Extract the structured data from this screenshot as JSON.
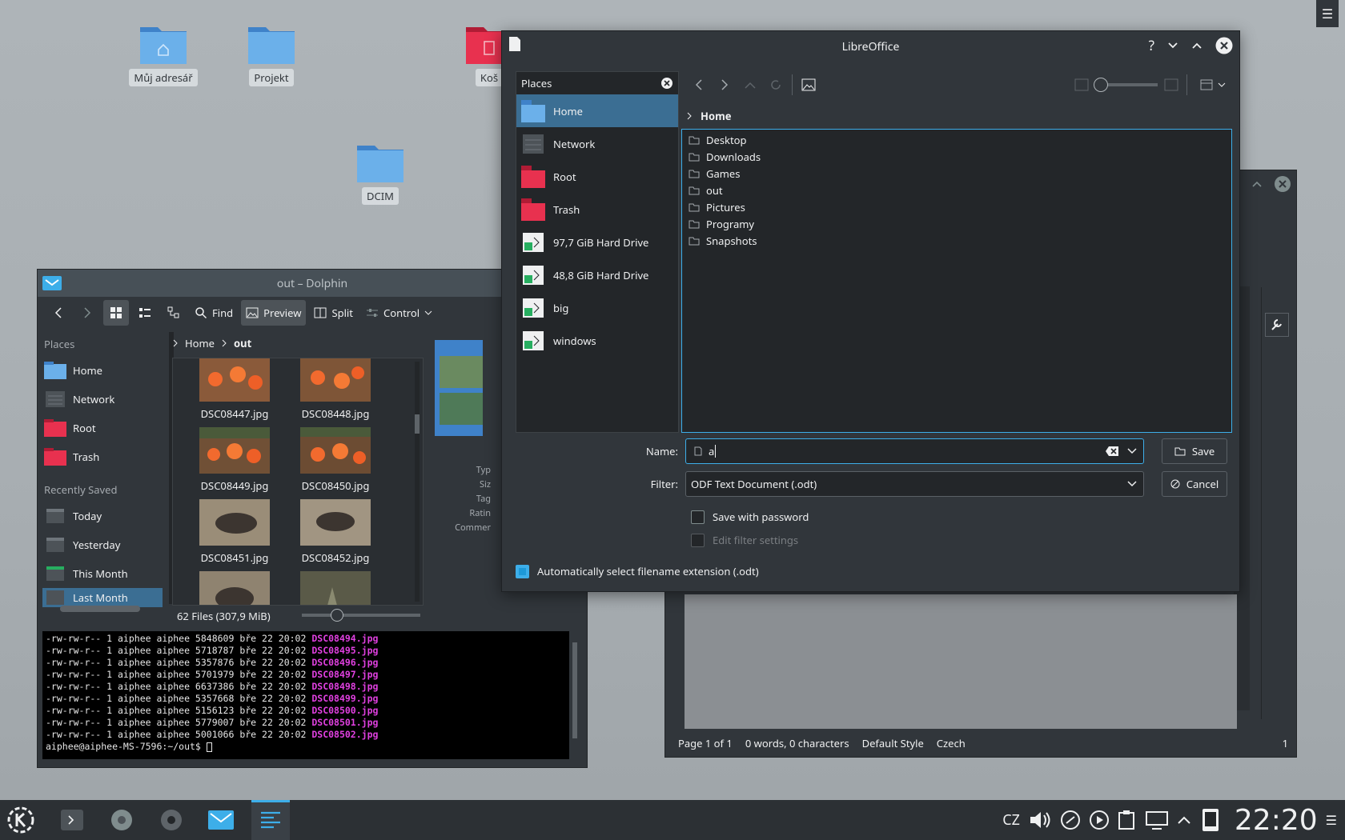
{
  "desktop": {
    "icons": [
      {
        "label": "Můj adresář"
      },
      {
        "label": "Projekt"
      },
      {
        "label": "Koš"
      },
      {
        "label": "DCIM"
      }
    ]
  },
  "dolphin": {
    "title": "out – Dolphin",
    "toolbar": {
      "find": "Find",
      "preview": "Preview",
      "split": "Split",
      "control": "Control"
    },
    "places_header": "Places",
    "places": [
      "Home",
      "Network",
      "Root",
      "Trash"
    ],
    "recent_header": "Recently Saved",
    "recent": [
      "Today",
      "Yesterday",
      "This Month",
      "Last Month"
    ],
    "breadcrumb": [
      "Home",
      "out"
    ],
    "files": [
      "DSC08447.jpg",
      "DSC08448.jpg",
      "DSC08449.jpg",
      "DSC08450.jpg",
      "DSC08451.jpg",
      "DSC08452.jpg"
    ],
    "info_labels": [
      "Typ",
      "Siz",
      "Tag",
      "Ratin",
      "Commer"
    ],
    "status": "62 Files (307,9 MiB)"
  },
  "terminal": {
    "lines": [
      {
        "prefix": "-rw-rw-r--  1 aiphee aiphee  5848609 bře 22 20:02 ",
        "file": "DSC08494.jpg"
      },
      {
        "prefix": "-rw-rw-r--  1 aiphee aiphee  5718787 bře 22 20:02 ",
        "file": "DSC08495.jpg"
      },
      {
        "prefix": "-rw-rw-r--  1 aiphee aiphee  5357876 bře 22 20:02 ",
        "file": "DSC08496.jpg"
      },
      {
        "prefix": "-rw-rw-r--  1 aiphee aiphee  5701979 bře 22 20:02 ",
        "file": "DSC08497.jpg"
      },
      {
        "prefix": "-rw-rw-r--  1 aiphee aiphee  6637386 bře 22 20:02 ",
        "file": "DSC08498.jpg"
      },
      {
        "prefix": "-rw-rw-r--  1 aiphee aiphee  5357668 bře 22 20:02 ",
        "file": "DSC08499.jpg"
      },
      {
        "prefix": "-rw-rw-r--  1 aiphee aiphee  5156123 bře 22 20:02 ",
        "file": "DSC08500.jpg"
      },
      {
        "prefix": "-rw-rw-r--  1 aiphee aiphee  5779007 bře 22 20:02 ",
        "file": "DSC08501.jpg"
      },
      {
        "prefix": "-rw-rw-r--  1 aiphee aiphee  5001066 bře 22 20:02 ",
        "file": "DSC08502.jpg"
      }
    ],
    "prompt": "aiphee@aiphee-MS-7596:~/out$ "
  },
  "writer": {
    "status": {
      "page": "Page 1 of 1",
      "words": "0 words, 0 characters",
      "style": "Default Style",
      "lang": "Czech",
      "zoom": "1"
    }
  },
  "dialog": {
    "title": "LibreOffice",
    "places_header": "Places",
    "places": [
      {
        "label": "Home",
        "icon": "home-folder-icon"
      },
      {
        "label": "Network",
        "icon": "network-icon"
      },
      {
        "label": "Root",
        "icon": "root-folder-icon"
      },
      {
        "label": "Trash",
        "icon": "trash-icon"
      },
      {
        "label": "97,7 GiB Hard Drive",
        "icon": "drive-icon"
      },
      {
        "label": "48,8 GiB Hard Drive",
        "icon": "drive-icon"
      },
      {
        "label": "big",
        "icon": "drive-icon"
      },
      {
        "label": "windows",
        "icon": "drive-icon"
      }
    ],
    "breadcrumb": "Home",
    "folders": [
      "Desktop",
      "Downloads",
      "Games",
      "out",
      "Pictures",
      "Programy",
      "Snapshots"
    ],
    "name_label": "Name:",
    "name_value": "a",
    "filter_label": "Filter:",
    "filter_value": "ODF Text Document (.odt)",
    "save_label": "Save",
    "cancel_label": "Cancel",
    "save_with_password": "Save with password",
    "edit_filter_settings": "Edit filter settings",
    "auto_extension": "Automatically select filename extension (.odt)"
  },
  "taskbar": {
    "keyboard_layout": "CZ",
    "clock": "22:20"
  },
  "colors": {
    "accent": "#3daee9",
    "selection": "#3b6e93",
    "folder_blue": "#5ea2de",
    "folder_red": "#e8314f",
    "window_bg": "#31363b"
  }
}
